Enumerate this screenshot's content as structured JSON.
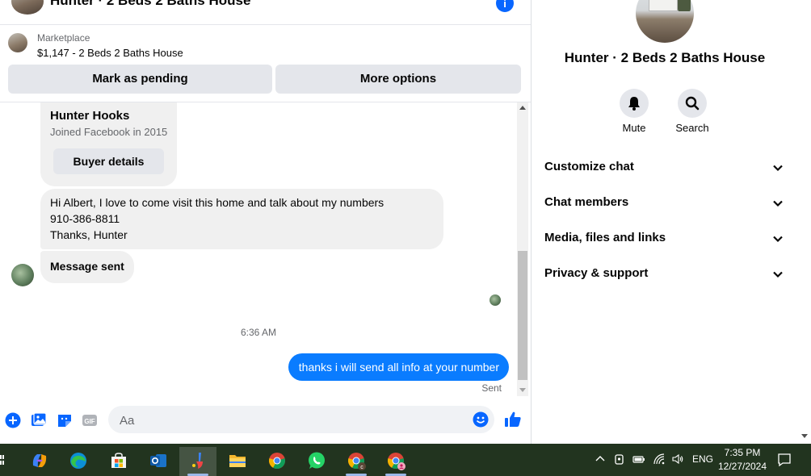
{
  "chat": {
    "header_title": "Hunter · 2 Beds 2 Baths House",
    "marketplace": {
      "label": "Marketplace",
      "listing": "$1,147 - 2 Beds 2 Baths House"
    },
    "actions": {
      "mark_pending": "Mark as pending",
      "more_options": "More options"
    },
    "buyer_card": {
      "name": "Hunter Hooks",
      "joined": "Joined Facebook in 2015",
      "details_button": "Buyer details"
    },
    "messages": {
      "incoming_1_line1": "Hi Albert, I love to come visit this home and talk about my numbers",
      "incoming_1_line2": "910-386-8811",
      "incoming_1_line3": "Thanks, Hunter",
      "incoming_2": "Message sent",
      "timestamp": "6:36 AM",
      "outgoing_1": "thanks i will send all info at your number",
      "status": "Sent"
    },
    "composer": {
      "placeholder": "Aa",
      "icons": [
        "plus-icon",
        "photo-icon",
        "sticker-icon",
        "gif-icon",
        "emoji-icon",
        "thumbs-up-icon"
      ]
    }
  },
  "info_panel": {
    "title": "Hunter · 2 Beds 2 Baths House",
    "mute_label": "Mute",
    "search_label": "Search",
    "sections": {
      "customize": "Customize chat",
      "members": "Chat members",
      "media": "Media, files and links",
      "privacy": "Privacy & support"
    }
  },
  "taskbar": {
    "apps": [
      "copilot-icon",
      "edge-icon",
      "store-icon",
      "outlook-icon",
      "paint-icon",
      "file-explorer-icon",
      "chrome-icon",
      "whatsapp-icon",
      "chrome-profile-c-icon",
      "chrome-profile-icon"
    ],
    "language": "ENG",
    "time": "7:35 PM",
    "date": "12/27/2024"
  },
  "colors": {
    "accent": "#0866ff",
    "outgoing_bubble": "#0a7cff",
    "incoming_bubble": "#f0f0f0",
    "taskbar": "#22341f"
  }
}
